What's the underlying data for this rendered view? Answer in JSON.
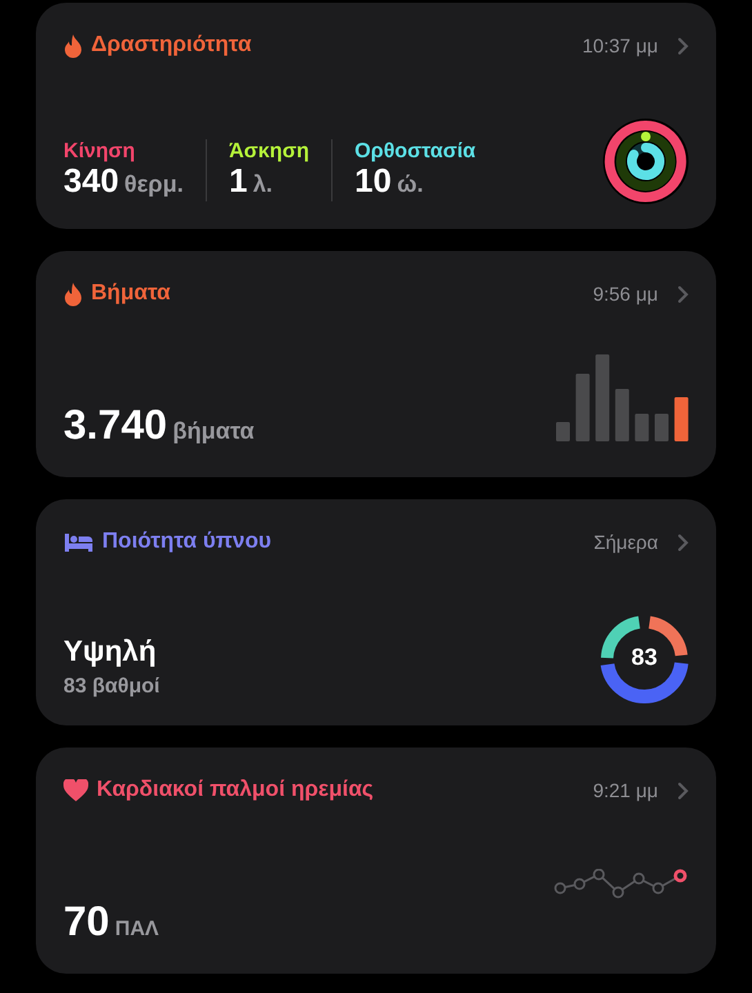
{
  "cards": [
    {
      "kind": "activity",
      "title": "Δραστηριότητα",
      "color": "#f0643a",
      "time": "10:37 μμ",
      "metrics": [
        {
          "label": "Κίνηση",
          "value": "340",
          "unit": "θερμ.",
          "color": "#f2456b"
        },
        {
          "label": "Άσκηση",
          "value": "1",
          "unit": "λ.",
          "color": "#b5f23a"
        },
        {
          "label": "Ορθοστασία",
          "value": "10",
          "unit": "ώ.",
          "color": "#5ce0e6"
        }
      ]
    },
    {
      "kind": "steps",
      "title": "Βήματα",
      "color": "#f0643a",
      "time": "9:56 μμ",
      "value": "3.740",
      "unit": "βήματα"
    },
    {
      "kind": "sleep",
      "title": "Ποιότητα ύπνου",
      "color": "#7d7ff0",
      "time": "Σήμερα",
      "value": "Υψηλή",
      "detail": "83 βαθμοί",
      "score": "83"
    },
    {
      "kind": "heart",
      "title": "Καρδιακοί παλμοί ηρεμίας",
      "color": "#f0506a",
      "time": "9:21 μμ",
      "value": "70",
      "unit": "ΠΑΛ"
    }
  ]
}
